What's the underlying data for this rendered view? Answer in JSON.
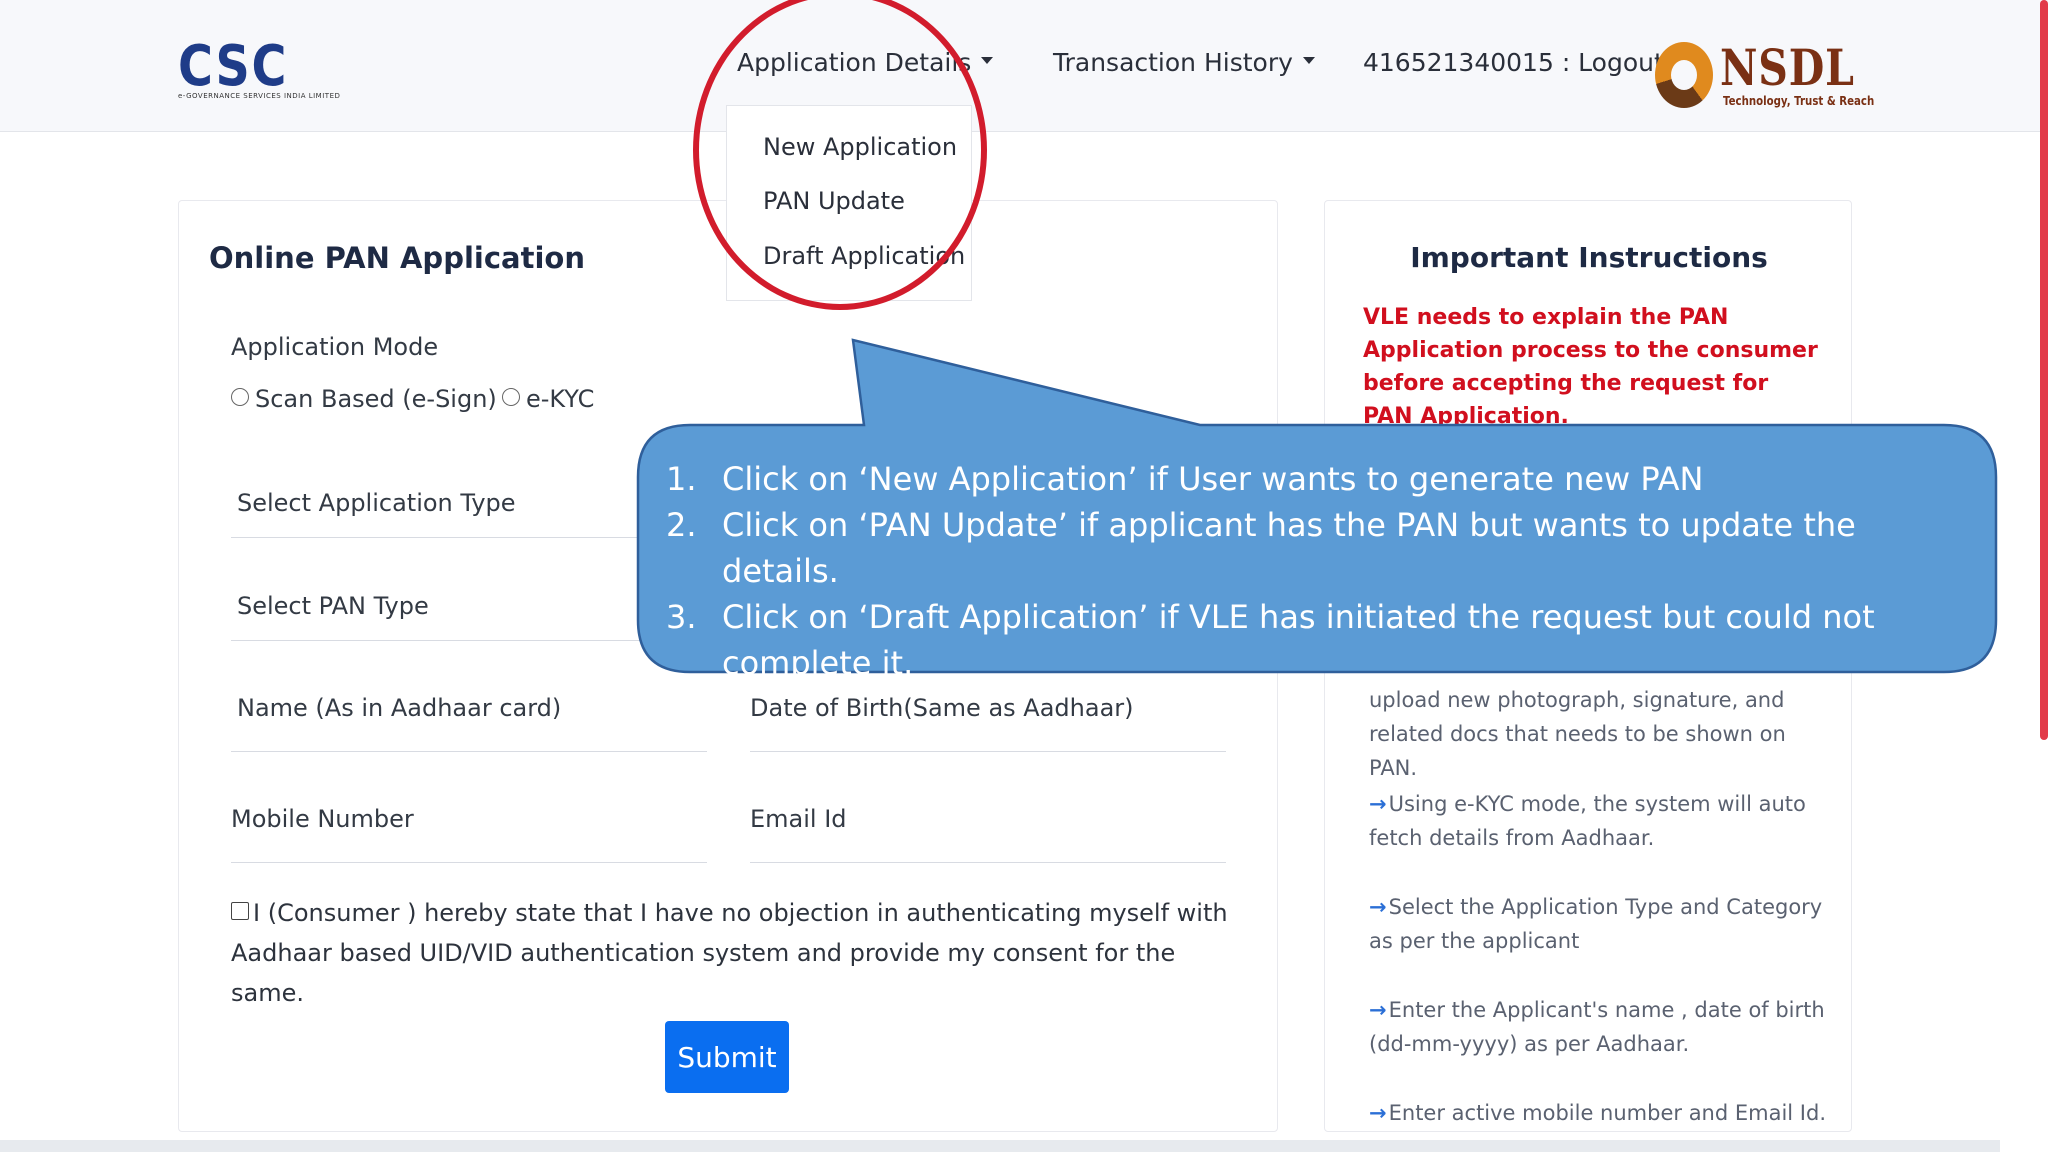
{
  "navbar": {
    "logo_text": "CSC",
    "logo_subtitle": "e-GOVERNANCE SERVICES INDIA LIMITED",
    "application_details": "Application Details",
    "transaction_history": "Transaction History",
    "user_logout": "416521340015 : Logout",
    "nsdl_text": "NSDL",
    "nsdl_tagline": "Technology, Trust & Reach"
  },
  "dropdown": {
    "items": [
      "New Application",
      "PAN Update",
      "Draft Application"
    ]
  },
  "form": {
    "title": "Online PAN Application",
    "mode_label": "Application Mode",
    "mode_options": [
      "Scan Based (e-Sign)",
      "e-KYC"
    ],
    "app_type_placeholder": "Select Application Type",
    "pan_type_placeholder": "Select PAN Type",
    "name_placeholder": "Name (As in Aadhaar card)",
    "dob_placeholder": "Date of Birth(Same as Aadhaar)",
    "mobile_placeholder": "Mobile Number",
    "email_placeholder": "Email Id",
    "consent_text": "I (Consumer ) hereby state that I have no objection in authenticating myself with Aadhaar based UID/VID authentication system and provide my consent for the same.",
    "submit_label": "Submit"
  },
  "instructions": {
    "title": "Important Instructions",
    "warning": "VLE needs to explain the PAN Application process to the consumer before accepting the request for PAN Application.",
    "items": [
      "upload new photograph, signature, and related docs that needs to be shown on PAN.",
      "Using e-KYC mode, the system will auto fetch details from Aadhaar.",
      "Select the Application Type and Category as per the applicant",
      "Enter the Applicant's name , date of birth (dd-mm-yyyy) as per Aadhaar.",
      "Enter active mobile number and Email Id."
    ]
  },
  "callout": {
    "items": [
      {
        "num": "1.",
        "text": "Click on ‘New Application’ if User wants to generate new PAN"
      },
      {
        "num": "2.",
        "text": "Click on ‘PAN Update’ if applicant has the PAN but wants to update the details."
      },
      {
        "num": "3.",
        "text": "Click on ‘Draft Application’ if VLE has initiated the request but could not complete it."
      }
    ]
  },
  "colors": {
    "navbar_bg": "#f7f8fb",
    "callout_fill": "#5b9bd5",
    "highlight_circle": "#d21c2c",
    "warning_text": "#d10f1e",
    "submit_bg": "#0a6ef0"
  }
}
